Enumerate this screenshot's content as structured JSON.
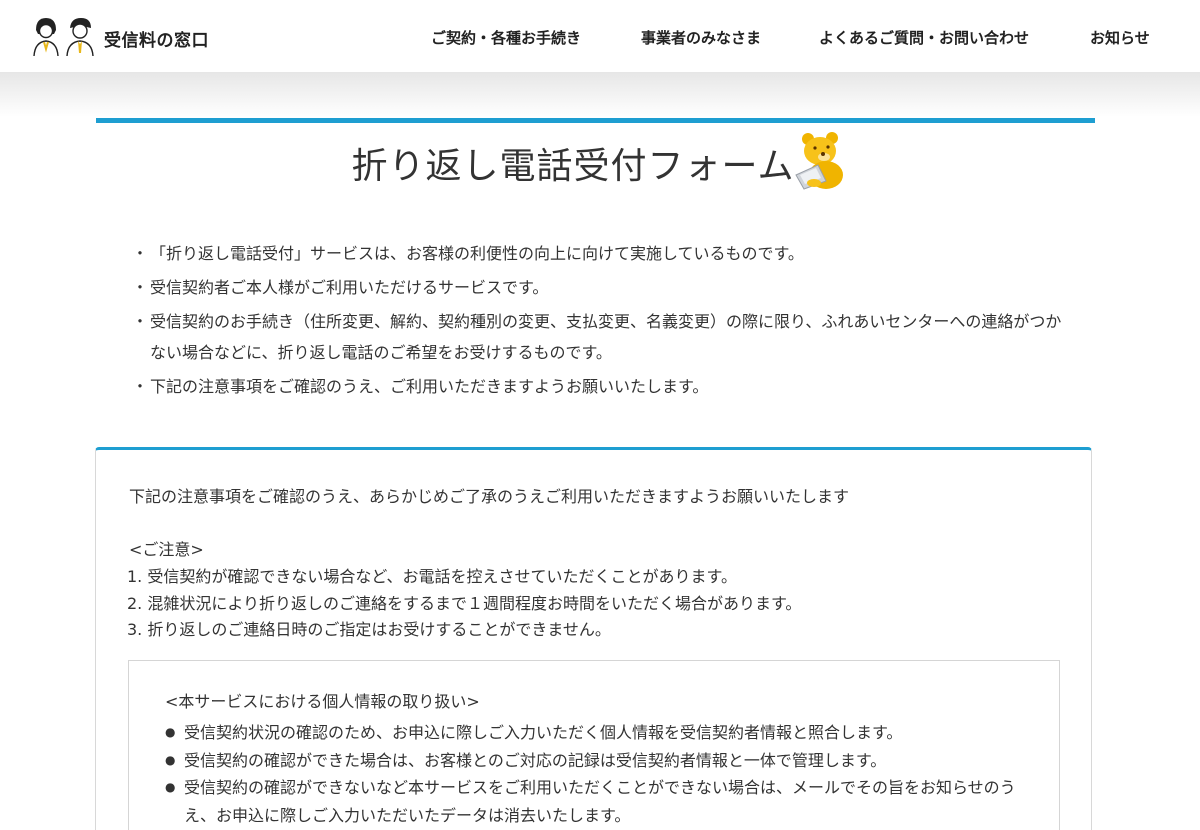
{
  "header": {
    "logo_text": "受信料の窓口",
    "logo_icon": "two-people-icon",
    "nav": [
      "ご契約・各種お手続き",
      "事業者のみなさま",
      "よくあるご質問・お問い合わせ",
      "お知らせ"
    ]
  },
  "page": {
    "title": "折り返し電話受付フォーム",
    "mascot_icon": "bear-mascot-icon"
  },
  "intro": {
    "bullet": "・",
    "items": [
      "「折り返し電話受付」サービスは、お客様の利便性の向上に向けて実施しているものです。",
      "受信契約者ご本人様がご利用いただけるサービスです。",
      "受信契約のお手続き（住所変更、解約、契約種別の変更、支払変更、名義変更）の際に限り、ふれあいセンターへの連絡がつかない場合などに、折り返し電話のご希望をお受けするものです。",
      "下記の注意事項をご確認のうえ、ご利用いただきますようお願いいたします。"
    ]
  },
  "notice": {
    "lead": "下記の注意事項をご確認のうえ、あらかじめご了承のうえご利用いただきますようお願いいたします",
    "caution_title": "<ご注意>",
    "cautions": [
      "1. 受信契約が確認できない場合など、お電話を控えさせていただくことがあります。",
      "2. 混雑状況により折り返しのご連絡をするまで１週間程度お時間をいただく場合があります。",
      "3. 折り返しのご連絡日時のご指定はお受けすることができません。"
    ],
    "privacy": {
      "title": "<本サービスにおける個人情報の取り扱い>",
      "bullet": "●",
      "items": [
        "受信契約状況の確認のため、お申込に際しご入力いただく個人情報を受信契約者情報と照合します。",
        "受信契約の確認ができた場合は、お客様とのご対応の記録は受信契約者情報と一体で管理します。",
        "受信契約の確認ができないなど本サービスをご利用いただくことができない場合は、メールでその旨をお知らせのうえ、お申込に際しご入力いただいたデータは消去いたします。"
      ]
    }
  },
  "colors": {
    "accent": "#1e9ed1",
    "text": "#333333",
    "border": "#d8d8d8"
  }
}
